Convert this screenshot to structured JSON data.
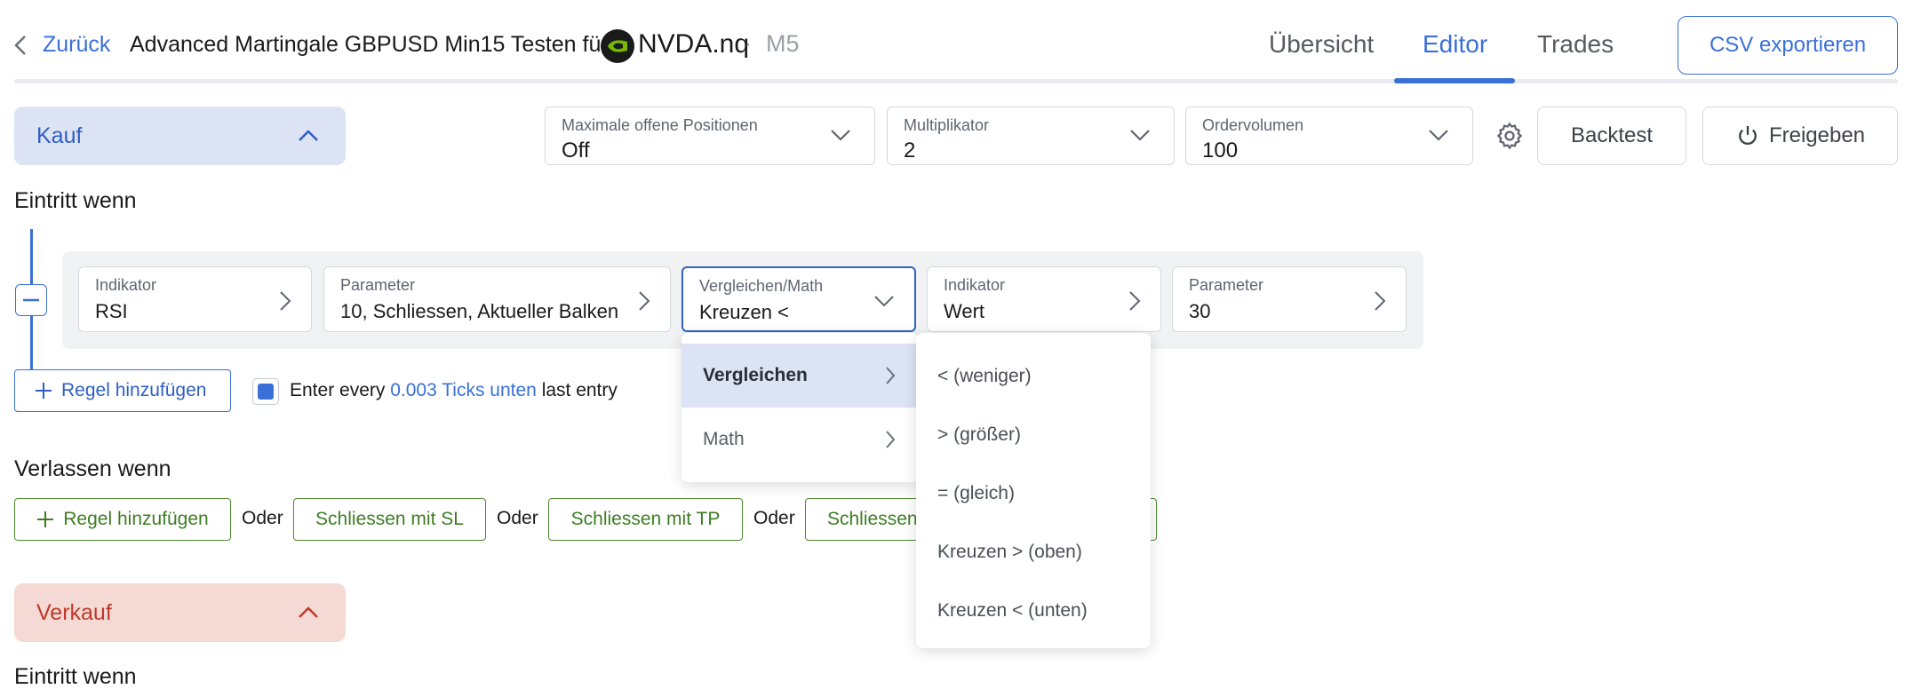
{
  "header": {
    "back_label": "Zurück",
    "strategy_title": "Advanced Martingale GBPUSD Min15 Testen für",
    "ticker": "NVDA.nq",
    "separator": "·",
    "timeframe": "M5",
    "tabs": [
      {
        "label": "Übersicht",
        "active": false
      },
      {
        "label": "Editor",
        "active": true
      },
      {
        "label": "Trades",
        "active": false
      }
    ],
    "csv_button": "CSV exportieren"
  },
  "buy_section": {
    "title": "Kauf",
    "selects": [
      {
        "label": "Maximale offene Positionen",
        "value": "Off"
      },
      {
        "label": "Multiplikator",
        "value": "2"
      },
      {
        "label": "Ordervolumen",
        "value": "100"
      }
    ],
    "backtest_button": "Backtest",
    "release_button": "Freigeben",
    "entry_label": "Eintritt wenn",
    "rule": {
      "indicator": {
        "label": "Indikator",
        "value": "RSI"
      },
      "parameter": {
        "label": "Parameter",
        "value": "10, Schliessen, Aktueller Balken"
      },
      "compare": {
        "label": "Vergleichen/Math",
        "value": "Kreuzen <"
      },
      "indicator2": {
        "label": "Indikator",
        "value": "Wert"
      },
      "parameter2": {
        "label": "Parameter",
        "value": "30"
      }
    },
    "add_rule_label": "Regel hinzufügen",
    "enter_every": {
      "checked": true,
      "prefix": "Enter every",
      "highlight": "0.003 Ticks unten",
      "suffix": "last entry"
    },
    "exit_label": "Verlassen wenn",
    "exit_add_rule_label": "Regel hinzufügen",
    "or_label": "Oder",
    "exit_buttons": [
      "Schliessen mit SL",
      "Schliessen mit TP",
      "Schliessen"
    ]
  },
  "sell_section": {
    "title": "Verkauf",
    "entry_label": "Eintritt wenn"
  },
  "dropdown": {
    "categories": [
      {
        "label": "Vergleichen",
        "active": true
      },
      {
        "label": "Math",
        "active": false
      }
    ],
    "options": [
      "< (weniger)",
      "> (größer)",
      "= (gleich)",
      "Kreuzen > (oben)",
      "Kreuzen < (unten)"
    ]
  },
  "colors": {
    "accent": "#3a70d8",
    "buy_bg": "#dbe3f5",
    "sell_bg": "#f4d9d4",
    "exit_green": "#4b8a2f"
  },
  "icons": [
    "chevron-left-icon",
    "nvidia-logo",
    "chevron-down-icon",
    "chevron-up-icon",
    "chevron-right-icon",
    "gear-icon",
    "power-icon",
    "plus-icon",
    "minus-icon"
  ]
}
